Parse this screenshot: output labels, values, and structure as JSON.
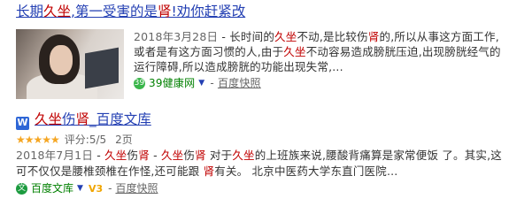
{
  "results": [
    {
      "title_parts": [
        "长期",
        "久坐",
        ",第一受害的是",
        "肾",
        "!劝你赶紧改"
      ],
      "date": "2018年3月28日",
      "snippet_parts": [
        " - 长时间的",
        "久坐",
        "不动,是比较伤",
        "肾",
        "的,所以从事这方面工作,或者是有这方面习惯的人,由于",
        "久坐",
        "不动容易造成膀胱压迫,出现膀胱经气的运行障碍,所以造成膀胱的功能出现失常,..."
      ],
      "source": "39健康网",
      "source_icon": "39-health-icon",
      "cache_label": "百度快照"
    },
    {
      "title_parts": [
        "久坐",
        "伤",
        "肾",
        "_百度文库"
      ],
      "rating_stars": "★★★★★",
      "rating_value": 5,
      "rating_text": "评分:5/5",
      "pages": "2页",
      "date": "2018年7月1日",
      "snippet_parts": [
        " - ",
        "久坐",
        "伤",
        "肾",
        " - ",
        "久坐",
        "伤",
        "肾",
        " 对于",
        "久坐",
        "的上班族来说,腰酸背痛算是家常便饭 了。其实,这可不仅仅是腰椎颈椎在作怪,还可能跟 ",
        "肾",
        "有关。 北京中医药大学东直门医院..."
      ],
      "source": "百度文库",
      "vip_label": "V3",
      "cache_label": "百度快照"
    }
  ],
  "colors": {
    "link_blue": "#2440b3",
    "highlight_red": "#c00000",
    "source_green": "#008000",
    "star_orange": "#f5a623"
  }
}
